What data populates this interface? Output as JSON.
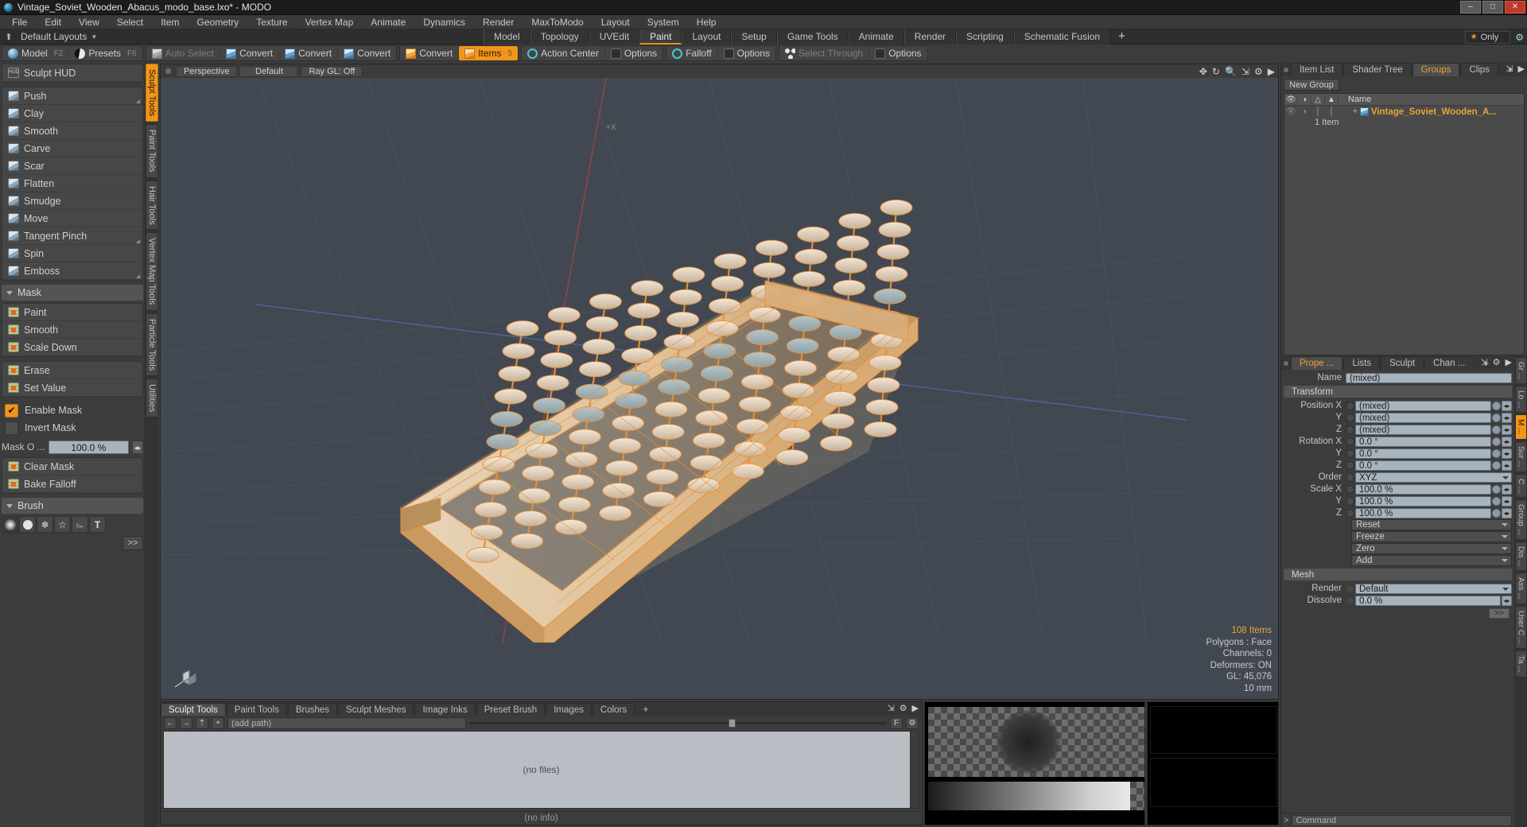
{
  "titlebar": {
    "title": "Vintage_Soviet_Wooden_Abacus_modo_base.lxo* - MODO",
    "minimize": "–",
    "maximize": "□",
    "close": "✕"
  },
  "menubar": {
    "items": [
      "File",
      "Edit",
      "View",
      "Select",
      "Item",
      "Geometry",
      "Texture",
      "Vertex Map",
      "Animate",
      "Dynamics",
      "Render",
      "MaxToModo",
      "Layout",
      "System",
      "Help"
    ]
  },
  "layoutbar": {
    "home_icon": "⬆",
    "layout_name": "Default Layouts",
    "tabs": [
      {
        "label": "Model",
        "active": false
      },
      {
        "label": "Topology",
        "active": false
      },
      {
        "label": "UVEdit",
        "active": false
      },
      {
        "label": "Paint",
        "active": true
      },
      {
        "label": "Layout",
        "active": false
      },
      {
        "label": "Setup",
        "active": false
      },
      {
        "label": "Game Tools",
        "active": false
      },
      {
        "label": "Animate",
        "active": false
      },
      {
        "label": "Render",
        "active": false
      },
      {
        "label": "Scripting",
        "active": false
      },
      {
        "label": "Schematic Fusion",
        "active": false
      }
    ],
    "add_tab": "+",
    "only_label": "Only",
    "star_icon": "★",
    "gear_icon": "⚙"
  },
  "toolbar": {
    "groups": [
      {
        "buttons": [
          {
            "label": "Model",
            "kbd": "F2",
            "icon": "sphere-icon",
            "state": "normal"
          },
          {
            "label": "Presets",
            "kbd": "F6",
            "icon": "moon-icon",
            "state": "normal"
          }
        ]
      },
      {
        "buttons": [
          {
            "label": "Auto Select",
            "kbd": "",
            "icon": "cube-grey-icon",
            "state": "dim"
          },
          {
            "label": "Convert",
            "kbd": "",
            "icon": "cube-blue-icon",
            "state": "normal"
          },
          {
            "label": "Convert",
            "kbd": "",
            "icon": "cube-blue-icon",
            "state": "normal"
          },
          {
            "label": "Convert",
            "kbd": "",
            "icon": "cube-blue-icon",
            "state": "normal"
          }
        ]
      },
      {
        "buttons": [
          {
            "label": "Convert",
            "kbd": "",
            "icon": "cube-orange-icon",
            "state": "normal"
          },
          {
            "label": "Items",
            "kbd": "5",
            "icon": "cube-orange-icon",
            "state": "active"
          }
        ]
      },
      {
        "buttons": [
          {
            "label": "Action Center",
            "kbd": "",
            "icon": "action-center-icon",
            "state": "normal"
          },
          {
            "label": "Options",
            "kbd": "",
            "icon": "options-square-icon",
            "state": "normal"
          }
        ]
      },
      {
        "buttons": [
          {
            "label": "Falloff",
            "kbd": "",
            "icon": "falloff-target-icon",
            "state": "normal"
          },
          {
            "label": "Options",
            "kbd": "",
            "icon": "options-square-icon",
            "state": "normal"
          }
        ]
      },
      {
        "buttons": [
          {
            "label": "Select Through",
            "kbd": "",
            "icon": "select-through-icon",
            "state": "dim"
          },
          {
            "label": "Options",
            "kbd": "",
            "icon": "options-square-icon",
            "state": "normal"
          }
        ]
      }
    ]
  },
  "left_panel": {
    "hud_row": {
      "label": "Sculpt HUD",
      "icon": "hud-icon"
    },
    "sculpt_tools": [
      {
        "label": "Push",
        "icon": "push-icon",
        "has_corner": true
      },
      {
        "label": "Clay",
        "icon": "clay-icon",
        "has_corner": false
      },
      {
        "label": "Smooth",
        "icon": "smooth-icon",
        "has_corner": false
      },
      {
        "label": "Carve",
        "icon": "carve-icon",
        "has_corner": false
      },
      {
        "label": "Scar",
        "icon": "scar-icon",
        "has_corner": false
      },
      {
        "label": "Flatten",
        "icon": "flatten-icon",
        "has_corner": false
      },
      {
        "label": "Smudge",
        "icon": "smudge-icon",
        "has_corner": false
      },
      {
        "label": "Move",
        "icon": "move-icon",
        "has_corner": false
      },
      {
        "label": "Tangent Pinch",
        "icon": "tangent-pinch-icon",
        "has_corner": true
      },
      {
        "label": "Spin",
        "icon": "spin-icon",
        "has_corner": false
      },
      {
        "label": "Emboss",
        "icon": "emboss-icon",
        "has_corner": true
      }
    ],
    "mask_section": {
      "title": "Mask",
      "tools_a": [
        {
          "label": "Paint",
          "icon": "mask-paint-icon"
        },
        {
          "label": "Smooth",
          "icon": "mask-smooth-icon"
        },
        {
          "label": "Scale Down",
          "icon": "mask-scale-down-icon"
        }
      ],
      "tools_b": [
        {
          "label": "Erase",
          "icon": "mask-erase-icon"
        },
        {
          "label": "Set Value",
          "icon": "mask-set-value-icon"
        }
      ],
      "enable_mask": {
        "label": "Enable Mask",
        "checked": true
      },
      "invert_mask": {
        "label": "Invert Mask",
        "checked": false
      },
      "opacity": {
        "label": "Mask O ...",
        "value": "100.0 %"
      },
      "tools_c": [
        {
          "label": "Clear Mask",
          "icon": "clear-mask-icon"
        },
        {
          "label": "Bake Falloff",
          "icon": "bake-falloff-icon"
        }
      ]
    },
    "brush_section": {
      "title": "Brush",
      "icons": [
        "soft-brush-icon",
        "hard-brush-icon",
        "texture-brush-icon",
        "star-brush-icon",
        "procedural-brush-icon",
        "text-brush-icon"
      ],
      "more_label": ">>"
    },
    "vertical_tabs": [
      {
        "label": "Sculpt Tools",
        "active": true
      },
      {
        "label": "Paint Tools",
        "active": false
      },
      {
        "label": "Hair Tools",
        "active": false
      },
      {
        "label": "Vertex Map Tools",
        "active": false
      },
      {
        "label": "Particle Tools",
        "active": false
      },
      {
        "label": "Utilities",
        "active": false
      }
    ]
  },
  "viewport": {
    "dropdowns": [
      "Perspective",
      "Default",
      "Ray GL: Off"
    ],
    "header_icons": [
      "move-view-icon",
      "rotate-view-icon",
      "zoom-view-icon",
      "fit-view-icon",
      "gear-icon",
      "chevron-right-icon"
    ],
    "axis_label_top": "+X",
    "stats": {
      "items": "108 Items",
      "polygons": "Polygons : Face",
      "channels": "Channels: 0",
      "deformers": "Deformers: ON",
      "gl": "GL: 45,076",
      "units": "10 mm"
    }
  },
  "bottom_panel": {
    "tabs": [
      {
        "label": "Sculpt Tools",
        "active": true
      },
      {
        "label": "Paint Tools",
        "active": false
      },
      {
        "label": "Brushes",
        "active": false
      },
      {
        "label": "Sculpt Meshes",
        "active": false
      },
      {
        "label": "Image Inks",
        "active": false
      },
      {
        "label": "Preset Brush",
        "active": false
      },
      {
        "label": "Images",
        "active": false
      },
      {
        "label": "Colors",
        "active": false
      }
    ],
    "add_tab": "+",
    "tab_icons": [
      "expand-icon",
      "gear-icon",
      "chevron-right-icon"
    ],
    "nav_buttons": [
      "back-icon",
      "forward-icon",
      "up-icon",
      "add-icon"
    ],
    "path_placeholder": "(add path)",
    "filter_button": "F",
    "options_button": "gear-icon",
    "empty_message": "(no files)",
    "status": "(no info)"
  },
  "right_panel": {
    "tabs": [
      {
        "label": "Item List",
        "active": false
      },
      {
        "label": "Shader Tree",
        "active": false
      },
      {
        "label": "Groups",
        "active": true
      },
      {
        "label": "Clips",
        "active": false
      }
    ],
    "add_tab": "+",
    "header_icons": [
      "expand-icon",
      "chevron-right-icon"
    ],
    "new_group_button": "New Group",
    "columns": [
      {
        "icon": "eye-icon"
      },
      {
        "icon": "shade-icon"
      },
      {
        "icon": "wire-icon"
      },
      {
        "icon": "lock-icon"
      },
      {
        "label": "Name"
      }
    ],
    "rows": [
      {
        "name": "Vintage_Soviet_Wooden_A...",
        "icon": "mesh-icon",
        "sub": "1 Item"
      }
    ]
  },
  "properties": {
    "tabs": [
      {
        "label": "Prope ...",
        "active": true
      },
      {
        "label": "Lists",
        "active": false
      },
      {
        "label": "Sculpt",
        "active": false
      },
      {
        "label": "Chan ...",
        "active": false
      }
    ],
    "add_tab": "+",
    "header_icons": [
      "expand-icon",
      "gear-icon",
      "chevron-right-icon"
    ],
    "name_label": "Name",
    "name_value": "(mixed)",
    "transform": {
      "title": "Transform",
      "rows": [
        {
          "label": "Position X",
          "value": "(mixed)"
        },
        {
          "label": "Y",
          "value": "(mixed)"
        },
        {
          "label": "Z",
          "value": "(mixed)"
        },
        {
          "label": "Rotation X",
          "value": "0.0 °"
        },
        {
          "label": "Y",
          "value": "0.0 °"
        },
        {
          "label": "Z",
          "value": "0.0 °"
        }
      ],
      "order_label": "Order",
      "order_value": "XYZ",
      "scale_rows": [
        {
          "label": "Scale X",
          "value": "100.0 %"
        },
        {
          "label": "Y",
          "value": "100.0 %"
        },
        {
          "label": "Z",
          "value": "100.0 %"
        }
      ],
      "buttons": [
        "Reset",
        "Freeze",
        "Zero",
        "Add"
      ]
    },
    "mesh": {
      "title": "Mesh",
      "render_label": "Render",
      "render_value": "Default",
      "dissolve_label": "Dissolve",
      "dissolve_value": "0.0 %",
      "more_button": ">>"
    },
    "vertical_tabs": [
      {
        "label": "Gr ...",
        "active": false
      },
      {
        "label": "Lo ...",
        "active": false
      },
      {
        "label": "M ...",
        "active": true
      },
      {
        "label": "Sur ...",
        "active": false
      },
      {
        "label": "C ...",
        "active": false
      },
      {
        "label": "Group ...",
        "active": false
      },
      {
        "label": "Dis ...",
        "active": false
      },
      {
        "label": "Ass ...",
        "active": false
      },
      {
        "label": "User C ...",
        "active": false
      },
      {
        "label": "Ta ...",
        "active": false
      }
    ]
  },
  "command_bar": {
    "prompt": ">",
    "placeholder": "Command"
  },
  "colors": {
    "accent_orange": "#f0951d",
    "wireframe_orange": "#e8913a",
    "panel_bg": "#3c3c3c",
    "viewport_bg": "#424851",
    "text": "#c8c8c8"
  }
}
